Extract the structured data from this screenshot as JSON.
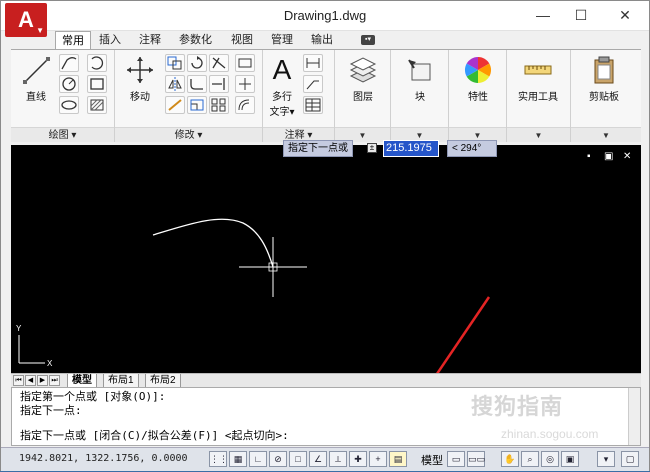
{
  "window": {
    "title": "Drawing1.dwg",
    "app_button_label": "A",
    "minimize_glyph": "—",
    "maximize_glyph": "☐",
    "close_glyph": "✕"
  },
  "ribbon_tabs": [
    "常用",
    "插入",
    "注释",
    "参数化",
    "视图",
    "管理",
    "输出"
  ],
  "ribbon_extra_tab_glyph": "▪▾",
  "panels": {
    "draw": {
      "title": "绘图 ▾",
      "line_label": "直线"
    },
    "modify": {
      "title": "修改 ▾",
      "move_label": "移动"
    },
    "annotation": {
      "title": "注释 ▾",
      "mtext_label_line1": "多行",
      "mtext_label_line2": "文字▾"
    },
    "layers": {
      "label": "图层"
    },
    "block": {
      "label": "块"
    },
    "properties": {
      "label": "特性"
    },
    "utilities": {
      "label": "实用工具"
    },
    "clipboard": {
      "label": "剪贴板"
    }
  },
  "drawing_area": {
    "controls": [
      "▪",
      "▣",
      "✕"
    ],
    "ucs_x": "X",
    "ucs_y": "Y"
  },
  "dynamic_input": {
    "prompt": "指定下一点或",
    "expand_glyph": "±",
    "length_value": "215.1975",
    "angle_value": "< 294°"
  },
  "layout_tabs": {
    "nav_arrows": [
      "⏮",
      "◀",
      "▶",
      "⏭"
    ],
    "tabs": [
      "模型",
      "布局1",
      "布局2"
    ]
  },
  "command_line": {
    "history": [
      "指定第一个点或 [对象(O)]:",
      "指定下一点:"
    ],
    "current": "指定下一点或 [闭合(C)/拟合公差(F)] <起点切向>:"
  },
  "status_bar": {
    "coordinates": "1942.8021,  1322.1756, 0.0000",
    "model_label": "模型"
  },
  "watermark": {
    "main": "搜狗指南",
    "sub": "zhinan.sogou.com"
  }
}
